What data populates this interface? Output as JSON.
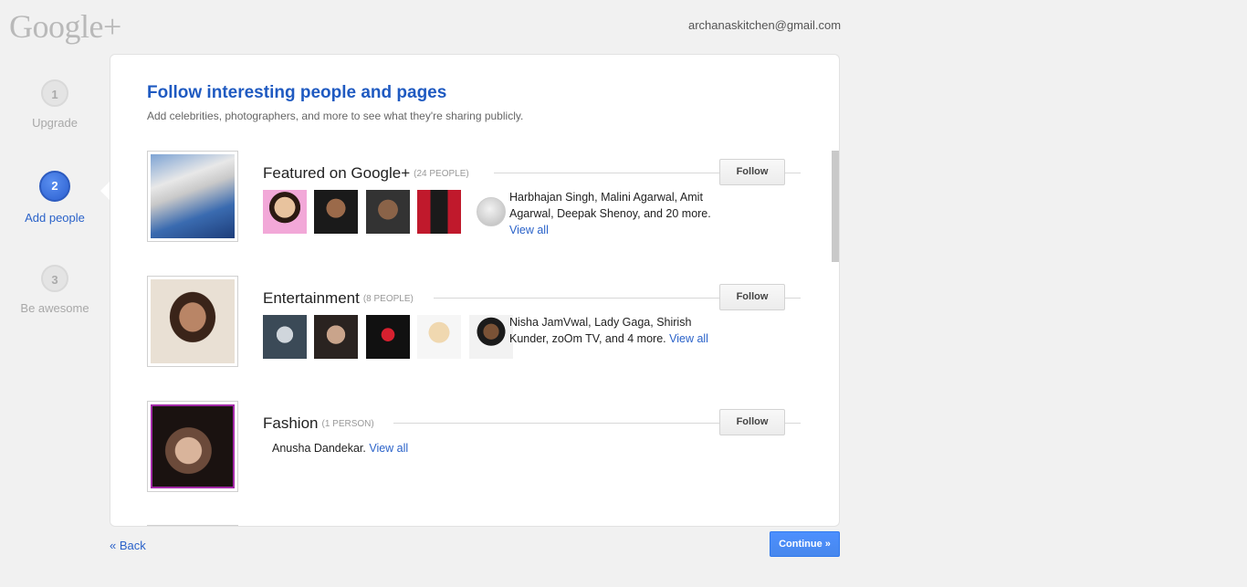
{
  "header": {
    "logo": "Google+",
    "email": "archanaskitchen@gmail.com"
  },
  "steps": [
    {
      "number": "1",
      "label": "Upgrade"
    },
    {
      "number": "2",
      "label": "Add people"
    },
    {
      "number": "3",
      "label": "Be awesome"
    }
  ],
  "main": {
    "title": "Follow interesting people and pages",
    "subtitle": "Add celebrities, photographers, and more to see what they're sharing publicly."
  },
  "sections": [
    {
      "title": "Featured on Google+",
      "count": "(24 PEOPLE)",
      "follow_label": "Follow",
      "description": "Harbhajan Singh, Malini Agarwal, Amit Agarwal, Deepak Shenoy, and 20 more.",
      "view_all": "View all"
    },
    {
      "title": "Entertainment",
      "count": "(8 PEOPLE)",
      "follow_label": "Follow",
      "description": "Nisha JamVwal, Lady Gaga, Shirish Kunder, zoOm TV, and 4 more.",
      "view_all": "View all"
    },
    {
      "title": "Fashion",
      "count": "(1 PERSON)",
      "follow_label": "Follow",
      "description": "Anusha Dandekar.",
      "view_all": "View all"
    }
  ],
  "footer": {
    "back_label": "« Back",
    "continue_label": "Continue »"
  },
  "colors": {
    "accent": "#1f5ac1",
    "link": "#2a62c9",
    "continue": "#4d90fe"
  }
}
